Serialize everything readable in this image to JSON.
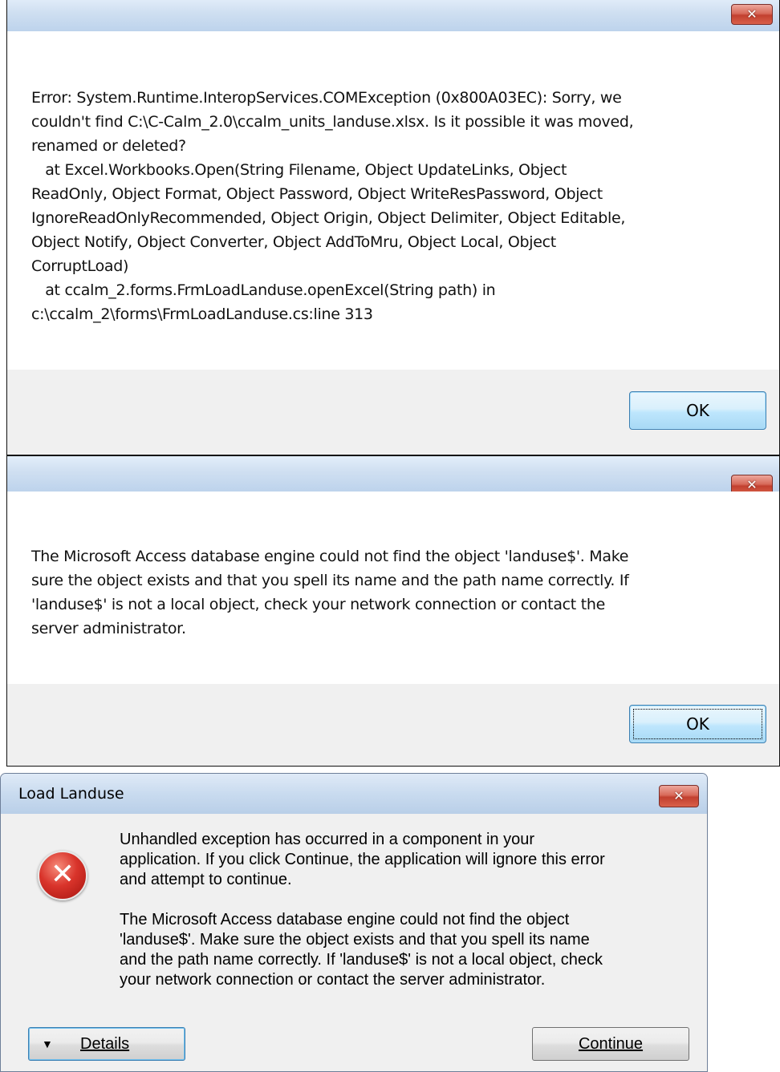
{
  "dialog1": {
    "close_glyph": "✕",
    "message": "Error: System.Runtime.InteropServices.COMException (0x800A03EC): Sorry, we\ncouldn't find C:\\C-Calm_2.0\\ccalm_units_landuse.xlsx. Is it possible it was moved,\nrenamed or deleted?\n   at Excel.Workbooks.Open(String Filename, Object UpdateLinks, Object\nReadOnly, Object Format, Object Password, Object WriteResPassword, Object\nIgnoreReadOnlyRecommended, Object Origin, Object Delimiter, Object Editable,\nObject Notify, Object Converter, Object AddToMru, Object Local, Object\nCorruptLoad)\n   at ccalm_2.forms.FrmLoadLanduse.openExcel(String path) in\nc:\\ccalm_2\\forms\\FrmLoadLanduse.cs:line 313",
    "ok_label": "OK"
  },
  "dialog2": {
    "close_glyph": "✕",
    "message": "The Microsoft Access database engine could not find the object 'landuse$'. Make\nsure the object exists and that you spell its name and the path name correctly. If\n'landuse$' is not a local object, check your network connection or contact the\nserver administrator.",
    "ok_label": "OK"
  },
  "dialog3": {
    "title": "Load Landuse",
    "close_glyph": "✕",
    "icon": "error-icon",
    "icon_glyph": "✕",
    "paragraph1": "Unhandled exception has occurred in a component in your\napplication. If you click Continue, the application will ignore this error\nand attempt to continue.",
    "paragraph2": "The Microsoft Access database engine could not find the object\n'landuse$'. Make sure the object exists and that you spell its name\nand the path name correctly. If 'landuse$' is not a local object, check\nyour network connection or contact the server administrator.",
    "details_caret": "▼",
    "details_label": "Details",
    "continue_label": "Continue"
  }
}
